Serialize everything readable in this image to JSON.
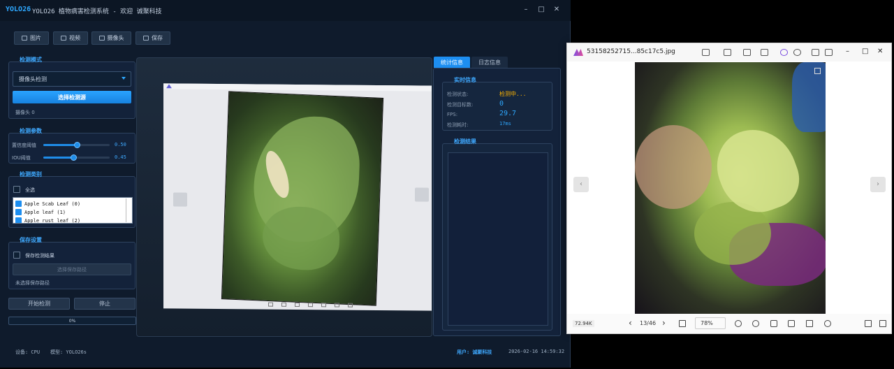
{
  "app": {
    "logo": "YOLO26",
    "title": "YOLO26 植物病害检测系统 - 欢迎 诚聚科技",
    "controls": [
      "–",
      "□",
      "✕"
    ]
  },
  "toolbar": [
    {
      "label": "图片",
      "icon": "image-icon"
    },
    {
      "label": "视频",
      "icon": "video-icon"
    },
    {
      "label": "摄像头",
      "icon": "camera-icon"
    },
    {
      "label": "保存",
      "icon": "save-icon"
    }
  ],
  "mode": {
    "title": "检测模式",
    "select_value": "摄像头检测",
    "button": "选择检测源",
    "camera_label": "摄像头 0"
  },
  "params": {
    "title": "检测参数",
    "conf_label": "置信度阈值",
    "conf_value": "0.50",
    "conf": 0.5,
    "iou_label": "IOU阈值",
    "iou_value": "0.45",
    "iou": 0.45
  },
  "classes": {
    "title": "检测类别",
    "select_all": "全选",
    "items": [
      "Apple Scab Leaf (0)",
      "Apple leaf (1)",
      "Apple rust leaf (2)"
    ]
  },
  "save": {
    "title": "保存设置",
    "checkbox": "保存检测结果",
    "path_button": "选择保存路径",
    "path_label": "未选择保存路径"
  },
  "actions": {
    "start": "开始检测",
    "stop": "停止",
    "progress": "0%"
  },
  "tabs": [
    "统计信息",
    "日志信息"
  ],
  "realtime": {
    "title": "实时信息",
    "rows": [
      {
        "label": "检测状态:",
        "value": "检测中...",
        "color": "#ffb400"
      },
      {
        "label": "检测目标数:",
        "value": "0",
        "color": "#2ea8ff"
      },
      {
        "label": "FPS:",
        "value": "29.7",
        "color": "#2ea8ff"
      },
      {
        "label": "检测耗时:",
        "value": "17ms",
        "color": "#2ea8ff"
      }
    ]
  },
  "results": {
    "title": "检测结果"
  },
  "statusbar": {
    "device": "设备: CPU",
    "model": "模型: YOLO26s",
    "user": "用户: 诚聚科技",
    "time": "2026-02-16 14:59:32"
  },
  "viewer": {
    "filename": "53158252715...85c17c5.jpg",
    "size": "72.94K",
    "page": "13/46",
    "zoom": "78%"
  }
}
